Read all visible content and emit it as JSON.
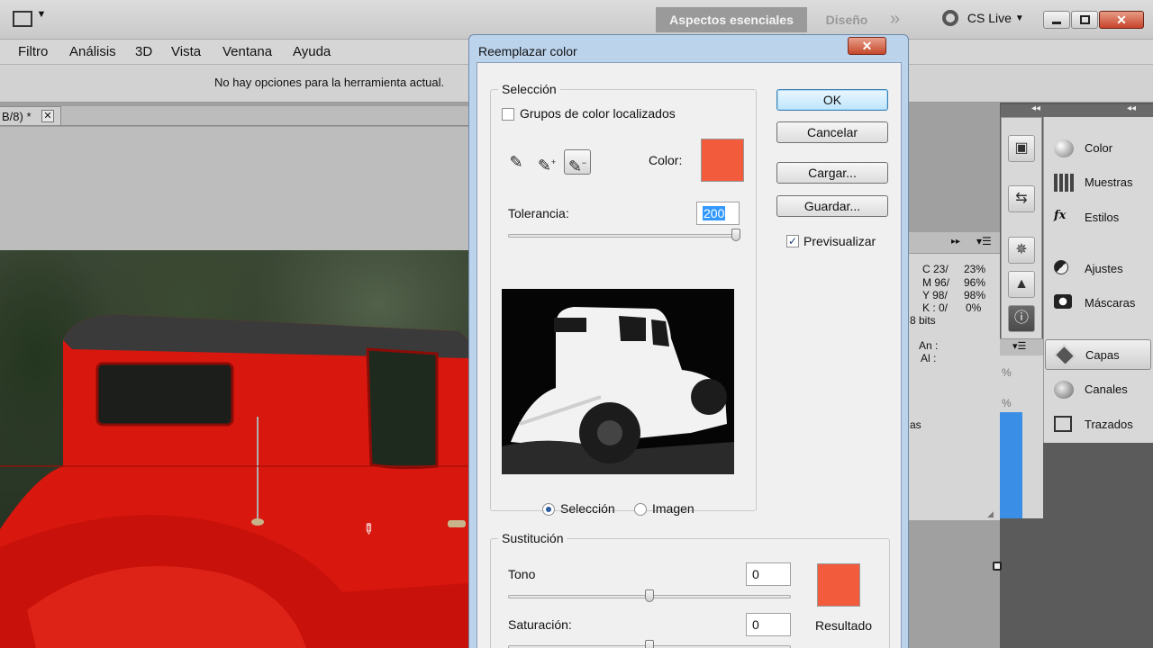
{
  "appbar": {
    "workspace_active": "Aspectos esenciales",
    "workspace_other": "Diseño",
    "more": "»",
    "cslive": "CS Live"
  },
  "menu": {
    "items": [
      "Filtro",
      "Análisis",
      "3D",
      "Vista",
      "Ventana",
      "Ayuda"
    ]
  },
  "options": {
    "text": "No hay opciones para la herramienta actual."
  },
  "document": {
    "tab_label": "B/8) *"
  },
  "panels": {
    "items": [
      {
        "label": "Color",
        "icon": "color-icon"
      },
      {
        "label": "Muestras",
        "icon": "swatches-icon"
      },
      {
        "label": "Estilos",
        "icon": "styles-icon"
      },
      {
        "label": "Ajustes",
        "icon": "adjustments-icon"
      },
      {
        "label": "Máscaras",
        "icon": "masks-icon"
      },
      {
        "label": "Capas",
        "icon": "layers-icon"
      },
      {
        "label": "Canales",
        "icon": "channels-icon"
      },
      {
        "label": "Trazados",
        "icon": "paths-icon"
      }
    ]
  },
  "info": {
    "c": "C 23/",
    "c_val": "23%",
    "m": "M 96/",
    "m_val": "96%",
    "y": "Y 98/",
    "y_val": "98%",
    "k": "K : 0/",
    "k_val": "0%",
    "bits": "8 bits",
    "an": "An :",
    "al": "Al :",
    "pct1": "%",
    "pct2": "%",
    "partial": "as"
  },
  "dialog": {
    "title": "Reemplazar color",
    "close": "✕",
    "seleccion": {
      "legend": "Selección",
      "localized_label": "Grupos de color localizados",
      "localized_checked": false,
      "color_label": "Color:",
      "color_hex": "#f25c3d",
      "tolerance_label": "Tolerancia:",
      "tolerance_value": "200",
      "tolerance_fraction": 1.0,
      "radio_selection": "Selección",
      "radio_image": "Imagen",
      "selected_mode": "Selección"
    },
    "buttons": {
      "ok": "OK",
      "cancel": "Cancelar",
      "load": "Cargar...",
      "save": "Guardar..."
    },
    "preview_label": "Previsualizar",
    "preview_checked": true,
    "sustitucion": {
      "legend": "Sustitución",
      "hue_label": "Tono",
      "hue_value": "0",
      "hue_fraction": 0.5,
      "saturation_label": "Saturación:",
      "saturation_value": "0",
      "saturation_fraction": 0.5,
      "result_label": "Resultado",
      "result_hex": "#f25c3d"
    }
  }
}
